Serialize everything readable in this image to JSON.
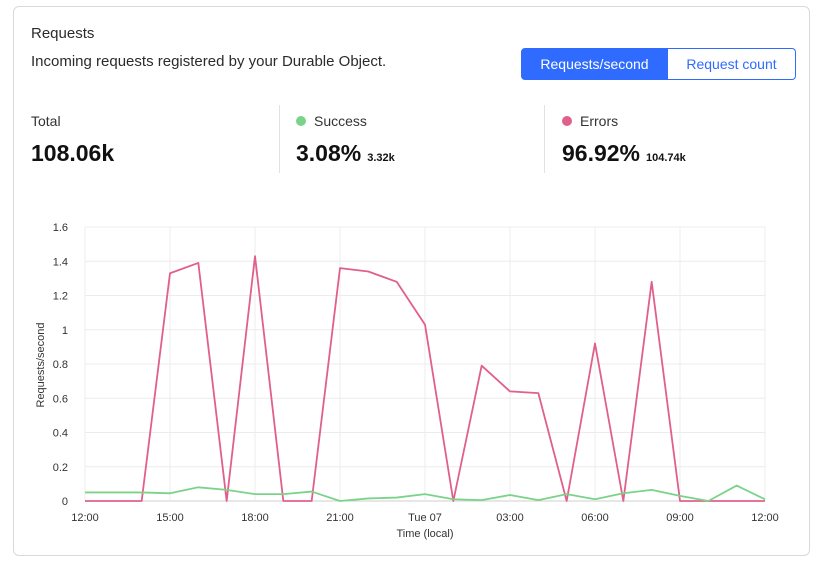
{
  "panel": {
    "title": "Requests",
    "subtitle": "Incoming requests registered by your Durable Object.",
    "toggle": {
      "active_label": "Requests/second",
      "inactive_label": "Request count"
    }
  },
  "stats": {
    "total": {
      "label": "Total",
      "value": "108.06k"
    },
    "success": {
      "label": "Success",
      "value": "3.08%",
      "sub": "3.32k",
      "color": "#7bd389"
    },
    "errors": {
      "label": "Errors",
      "value": "96.92%",
      "sub": "104.74k",
      "color": "#e0608a"
    }
  },
  "chart_data": {
    "type": "line",
    "xlabel": "Time (local)",
    "ylabel": "Requests/second",
    "ylim": [
      0,
      1.6
    ],
    "yticks": [
      "0",
      "0.2",
      "0.4",
      "0.6",
      "0.8",
      "1",
      "1.2",
      "1.4",
      "1.6"
    ],
    "xticks": [
      "12:00",
      "15:00",
      "18:00",
      "21:00",
      "Tue 07",
      "03:00",
      "06:00",
      "09:00",
      "12:00"
    ],
    "grid": true,
    "x": [
      0,
      1,
      2,
      3,
      4,
      5,
      6,
      7,
      8,
      9,
      10,
      11,
      12,
      13,
      14,
      15,
      16,
      17,
      18,
      19,
      20,
      21,
      22,
      23,
      24
    ],
    "series": [
      {
        "name": "Errors",
        "color": "#e0608a",
        "values": [
          0,
          0,
          0,
          1.33,
          1.39,
          0,
          1.43,
          0,
          0,
          1.36,
          1.34,
          1.28,
          1.03,
          0,
          0.79,
          0.64,
          0.63,
          0,
          0.92,
          0,
          1.28,
          0,
          0,
          0,
          0
        ]
      },
      {
        "name": "Success",
        "color": "#7bd389",
        "values": [
          0.05,
          0.05,
          0.05,
          0.045,
          0.08,
          0.065,
          0.04,
          0.04,
          0.055,
          0,
          0.015,
          0.02,
          0.04,
          0.01,
          0.005,
          0.035,
          0.005,
          0.04,
          0.01,
          0.045,
          0.065,
          0.03,
          0,
          0.09,
          0.01
        ]
      }
    ]
  }
}
